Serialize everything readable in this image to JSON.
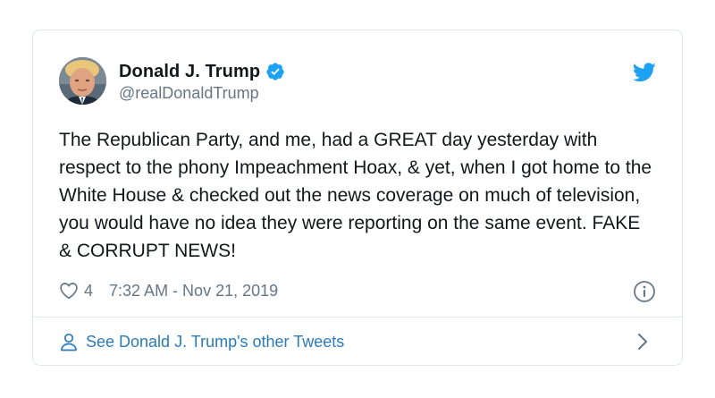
{
  "tweet": {
    "display_name": "Donald J. Trump",
    "handle": "@realDonaldTrump",
    "verified": true,
    "text": "The Republican Party, and me, had a GREAT day yesterday with respect to the phony Impeachment Hoax, & yet, when I got home to the White House & checked out the news coverage on much of television, you would have no idea they were reporting on the same event. FAKE & CORRUPT NEWS!",
    "likes": "4",
    "timestamp": "7:32 AM - Nov 21, 2019"
  },
  "footer": {
    "link_text": "See Donald J. Trump's other Tweets"
  },
  "icons": {
    "verified": "verified-badge-icon",
    "brand": "twitter-bird-icon",
    "like": "heart-icon",
    "info": "info-icon",
    "user": "user-icon",
    "chevron": "chevron-right-icon"
  },
  "colors": {
    "brand_blue": "#1da1f2",
    "link_blue": "#2b7bb9",
    "text": "#14171a",
    "secondary": "#657786",
    "border": "#e1e8ed"
  }
}
